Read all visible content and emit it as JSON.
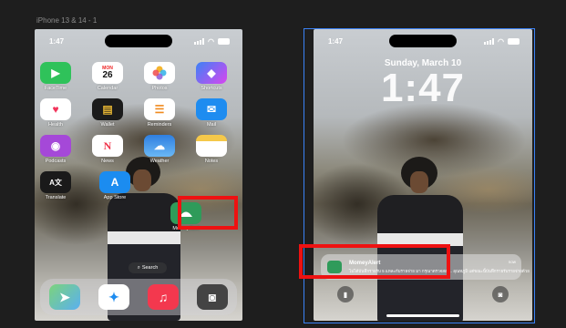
{
  "frame_label": "iPhone 13 & 14 - 1",
  "status_time": "1:47",
  "home_apps": [
    {
      "label": "FaceTime",
      "glyph": "▶",
      "color": "#2fc25a"
    },
    {
      "label": "Calendar",
      "glyph": "26",
      "color": "#ffffff",
      "sub": "MON"
    },
    {
      "label": "Photos",
      "glyph": "✿",
      "color": "#ffffff"
    },
    {
      "label": "Shortcuts",
      "glyph": "◆",
      "color": "#5a3bd6"
    },
    {
      "label": "Health",
      "glyph": "♥",
      "color": "#ffffff"
    },
    {
      "label": "Wallet",
      "glyph": "▤",
      "color": "#1b1b1b"
    },
    {
      "label": "Reminders",
      "glyph": "☰",
      "color": "#ffffff"
    },
    {
      "label": "Mail",
      "glyph": "✉",
      "color": "#1e8cf0"
    },
    {
      "label": "Podcasts",
      "glyph": "◉",
      "color": "#a548d8"
    },
    {
      "label": "News",
      "glyph": "N",
      "color": "#ffffff"
    },
    {
      "label": "Weather",
      "glyph": "☁",
      "color": "#3aa0f0"
    },
    {
      "label": "Notes",
      "glyph": "▭",
      "color": "#ffffff"
    },
    {
      "label": "Translate",
      "glyph": "A文",
      "color": "#1a1a1a"
    },
    {
      "label": "App Store",
      "glyph": "A",
      "color": "#1b8cf0"
    }
  ],
  "money_alert_label": "MomeyAlert",
  "search_label": "Search",
  "dock_icons": [
    "maps-icon",
    "safari-icon",
    "music-icon",
    "camera-icon"
  ],
  "lock": {
    "date": "Sunday, March 10",
    "time": "1:47",
    "notification": {
      "app": "MomeyAlert",
      "message": "ไม่ได้บันทึกรายรับ 5 แหละกับรายจ่าย มา กรุณาตรวจสอบ..  อุณหภูมิ แต่ขณะนี้บันทึกรายรับรายจ่ายด้วย",
      "time": "now"
    }
  },
  "colors": {
    "highlight": "#ee1111",
    "selection": "#3b82f6",
    "money_alert_green": "#2f9b5a"
  }
}
